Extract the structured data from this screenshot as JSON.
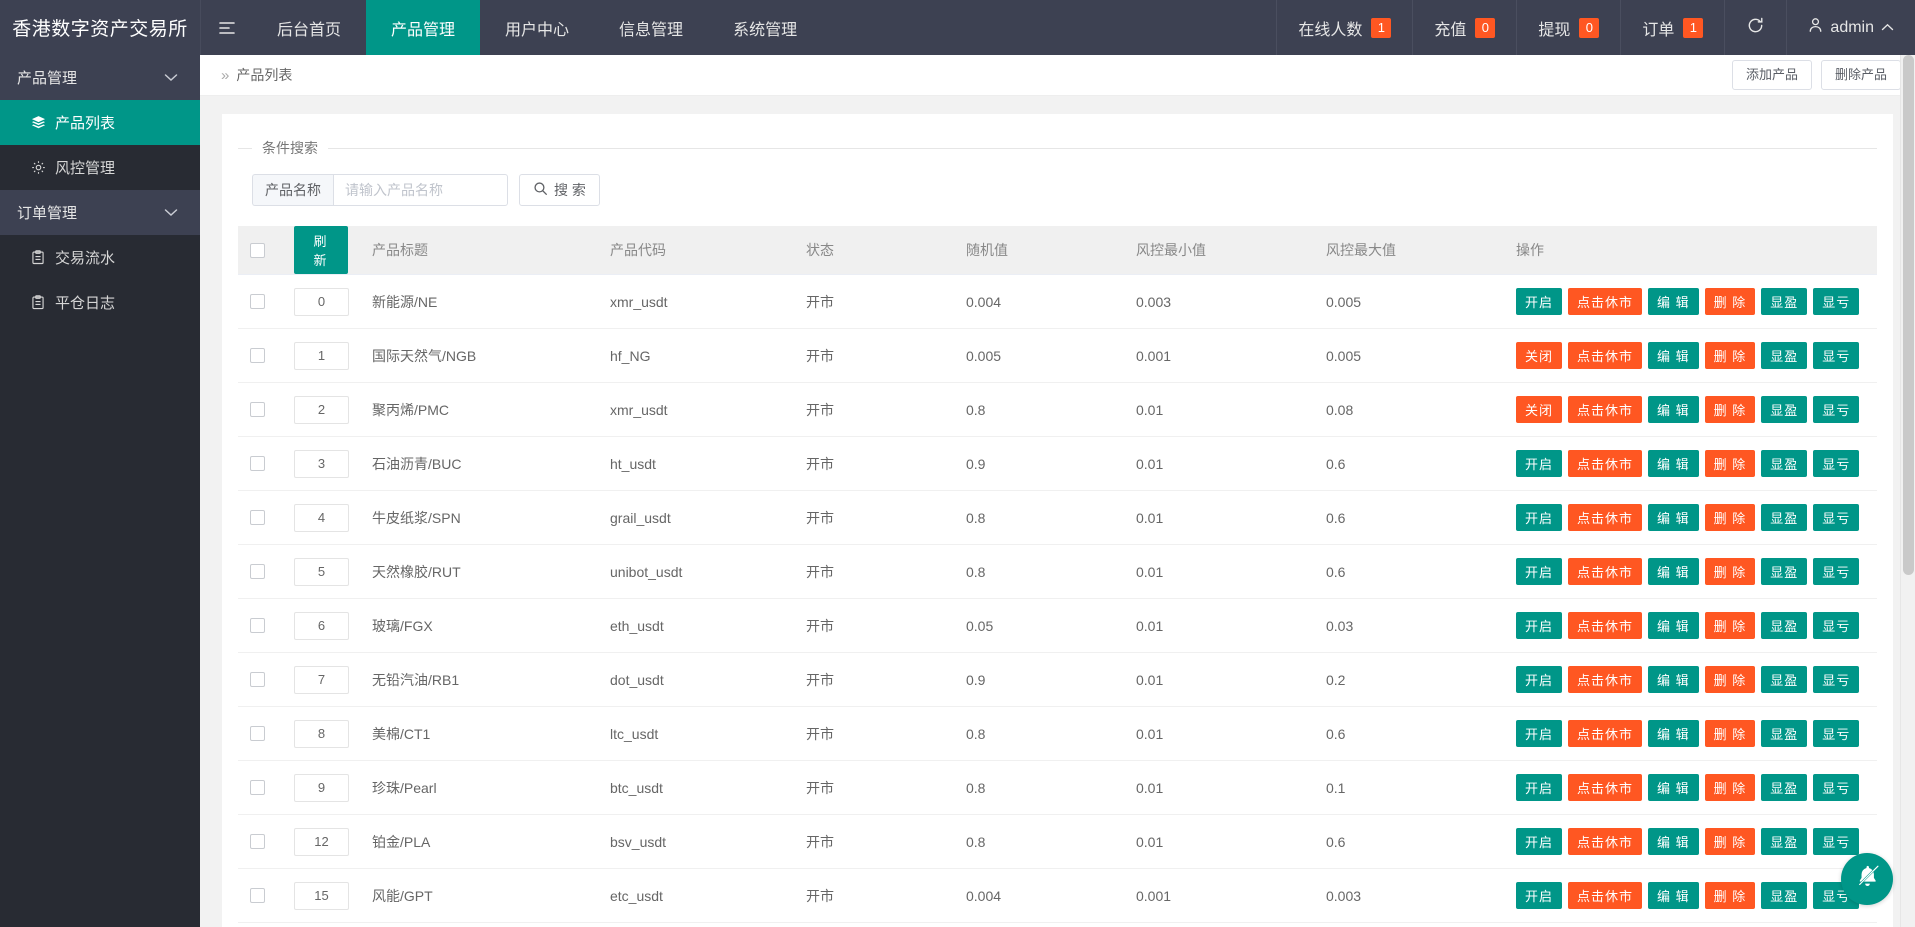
{
  "header": {
    "brand": "香港数字资产交易所",
    "hamburger_icon": "list-icon",
    "nav": [
      {
        "label": "后台首页",
        "active": false
      },
      {
        "label": "产品管理",
        "active": true
      },
      {
        "label": "用户中心",
        "active": false
      },
      {
        "label": "信息管理",
        "active": false
      },
      {
        "label": "系统管理",
        "active": false
      }
    ],
    "stats": [
      {
        "label": "在线人数",
        "value": "1"
      },
      {
        "label": "充值",
        "value": "0"
      },
      {
        "label": "提现",
        "value": "0"
      },
      {
        "label": "订单",
        "value": "1"
      }
    ],
    "refresh_icon": "refresh-icon",
    "user": {
      "icon": "user-icon",
      "name": "admin",
      "caret": "chevron-up-icon"
    },
    "colors": {
      "bar_bg": "#3d4152",
      "accent": "#009688",
      "badge": "#ff5722"
    }
  },
  "sidebar": {
    "groups": [
      {
        "label": "产品管理",
        "chevron": "chevron-down-icon",
        "items": [
          {
            "label": "产品列表",
            "icon": "layers-icon",
            "active": true
          },
          {
            "label": "风控管理",
            "icon": "gear-icon",
            "active": false
          }
        ]
      },
      {
        "label": "订单管理",
        "chevron": "chevron-down-icon",
        "items": [
          {
            "label": "交易流水",
            "icon": "clipboard-icon",
            "active": false
          },
          {
            "label": "平仓日志",
            "icon": "clipboard-icon",
            "active": false
          }
        ]
      }
    ]
  },
  "breadcrumb": {
    "separator": "»",
    "current": "产品列表",
    "actions": [
      {
        "label": "添加产品",
        "name": "add-product-button"
      },
      {
        "label": "删除产品",
        "name": "delete-product-button"
      }
    ]
  },
  "search": {
    "legend": "条件搜索",
    "field_label": "产品名称",
    "placeholder": "请输入产品名称",
    "value": "",
    "button_label": "搜 索",
    "button_icon": "search-icon"
  },
  "table": {
    "refresh_label": "刷 新",
    "columns": [
      "产品标题",
      "产品代码",
      "状态",
      "随机值",
      "风控最小值",
      "风控最大值",
      "操作"
    ],
    "op_labels": {
      "open": "开启",
      "close": "关闭",
      "halt": "点击休市",
      "edit": "编 辑",
      "delete": "删 除",
      "profit": "显盈",
      "loss": "显亏"
    },
    "rows": [
      {
        "id": "0",
        "title": "新能源/NE",
        "code": "xmr_usdt",
        "state": "开市",
        "random": "0.004",
        "min": "0.003",
        "max": "0.005",
        "toggle": "开启"
      },
      {
        "id": "1",
        "title": "国际天然气/NGB",
        "code": "hf_NG",
        "state": "开市",
        "random": "0.005",
        "min": "0.001",
        "max": "0.005",
        "toggle": "关闭"
      },
      {
        "id": "2",
        "title": "聚丙烯/PMC",
        "code": "xmr_usdt",
        "state": "开市",
        "random": "0.8",
        "min": "0.01",
        "max": "0.08",
        "toggle": "关闭"
      },
      {
        "id": "3",
        "title": "石油沥青/BUC",
        "code": "ht_usdt",
        "state": "开市",
        "random": "0.9",
        "min": "0.01",
        "max": "0.6",
        "toggle": "开启"
      },
      {
        "id": "4",
        "title": "牛皮纸浆/SPN",
        "code": "grail_usdt",
        "state": "开市",
        "random": "0.8",
        "min": "0.01",
        "max": "0.6",
        "toggle": "开启"
      },
      {
        "id": "5",
        "title": "天然橡胶/RUT",
        "code": "unibot_usdt",
        "state": "开市",
        "random": "0.8",
        "min": "0.01",
        "max": "0.6",
        "toggle": "开启"
      },
      {
        "id": "6",
        "title": "玻璃/FGX",
        "code": "eth_usdt",
        "state": "开市",
        "random": "0.05",
        "min": "0.01",
        "max": "0.03",
        "toggle": "开启"
      },
      {
        "id": "7",
        "title": "无铅汽油/RB1",
        "code": "dot_usdt",
        "state": "开市",
        "random": "0.9",
        "min": "0.01",
        "max": "0.2",
        "toggle": "开启"
      },
      {
        "id": "8",
        "title": "美棉/CT1",
        "code": "ltc_usdt",
        "state": "开市",
        "random": "0.8",
        "min": "0.01",
        "max": "0.6",
        "toggle": "开启"
      },
      {
        "id": "9",
        "title": "珍珠/Pearl",
        "code": "btc_usdt",
        "state": "开市",
        "random": "0.8",
        "min": "0.01",
        "max": "0.1",
        "toggle": "开启"
      },
      {
        "id": "12",
        "title": "铂金/PLA",
        "code": "bsv_usdt",
        "state": "开市",
        "random": "0.8",
        "min": "0.01",
        "max": "0.6",
        "toggle": "开启"
      },
      {
        "id": "15",
        "title": "风能/GPT",
        "code": "etc_usdt",
        "state": "开市",
        "random": "0.004",
        "min": "0.001",
        "max": "0.003",
        "toggle": "开启"
      }
    ]
  },
  "fab": {
    "icon": "bell-off-icon"
  }
}
